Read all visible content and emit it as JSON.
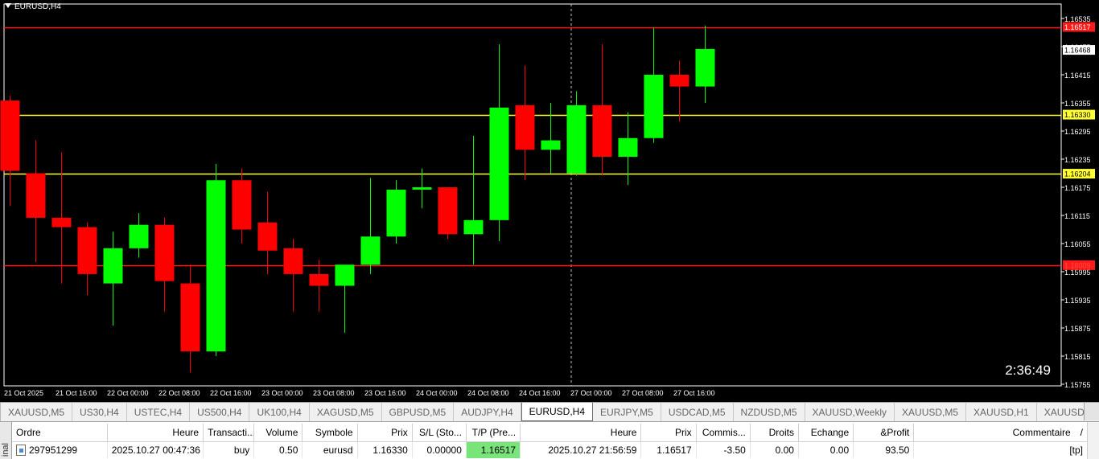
{
  "chart": {
    "title": "EURUSD,H4",
    "timer": "2:36:49",
    "price_labels": [
      "1.16535",
      "1.16475",
      "1.16415",
      "1.16355",
      "1.16295",
      "1.16235",
      "1.16175",
      "1.16115",
      "1.16055",
      "1.15995",
      "1.15935",
      "1.15875",
      "1.15815",
      "1.15755"
    ],
    "markers": [
      {
        "label": "1.16517",
        "price": 1.16517,
        "line_color": "#ff1a1a",
        "badge_bg": "#ff1a1a",
        "badge_fg": "#ffffff"
      },
      {
        "label": "1.16468",
        "price": 1.16468,
        "line_color": null,
        "badge_bg": "#ffffff",
        "badge_fg": "#000000"
      },
      {
        "label": "1.16330",
        "price": 1.1633,
        "line_color": "#ffff33",
        "badge_bg": "#ffff33",
        "badge_fg": "#000000"
      },
      {
        "label": "1.16204",
        "price": 1.16204,
        "line_color": "#ffff33",
        "badge_bg": "#ffff33",
        "badge_fg": "#000000"
      },
      {
        "label": "1.16009",
        "price": 1.16009,
        "line_color": "#ff1a1a",
        "badge_bg": "#ff1a1a",
        "badge_fg": "#ff4d4d"
      }
    ],
    "time_labels": [
      "21 Oct 2025",
      "21 Oct 16:00",
      "22 Oct 00:00",
      "22 Oct 08:00",
      "22 Oct 16:00",
      "23 Oct 00:00",
      "23 Oct 08:00",
      "23 Oct 16:00",
      "24 Oct 00:00",
      "24 Oct 08:00",
      "24 Oct 16:00",
      "27 Oct 00:00",
      "27 Oct 08:00",
      "27 Oct 16:00"
    ],
    "colors": {
      "bull": "#00ff00",
      "bear": "#ff0000",
      "background": "#000000",
      "grid_text": "#ffffff"
    }
  },
  "chart_data": {
    "type": "candlestick",
    "title": "EURUSD,H4",
    "xlabel": "",
    "ylabel": "",
    "ylim": [
      1.1573,
      1.1656
    ],
    "grid": false,
    "candles": [
      {
        "o": 1.1636,
        "h": 1.1637,
        "l": 1.16135,
        "c": 1.1621
      },
      {
        "o": 1.16205,
        "h": 1.16275,
        "l": 1.16015,
        "c": 1.1611
      },
      {
        "o": 1.1611,
        "h": 1.1625,
        "l": 1.1597,
        "c": 1.1609
      },
      {
        "o": 1.1609,
        "h": 1.161,
        "l": 1.15945,
        "c": 1.1599
      },
      {
        "o": 1.1597,
        "h": 1.1608,
        "l": 1.1588,
        "c": 1.16045
      },
      {
        "o": 1.16045,
        "h": 1.1612,
        "l": 1.16025,
        "c": 1.16095
      },
      {
        "o": 1.16095,
        "h": 1.1611,
        "l": 1.1591,
        "c": 1.15975
      },
      {
        "o": 1.1597,
        "h": 1.1601,
        "l": 1.1578,
        "c": 1.15825
      },
      {
        "o": 1.15825,
        "h": 1.16225,
        "l": 1.15815,
        "c": 1.1619
      },
      {
        "o": 1.1619,
        "h": 1.16215,
        "l": 1.16055,
        "c": 1.16085
      },
      {
        "o": 1.161,
        "h": 1.16165,
        "l": 1.1599,
        "c": 1.1604
      },
      {
        "o": 1.16045,
        "h": 1.16065,
        "l": 1.1591,
        "c": 1.1599
      },
      {
        "o": 1.1599,
        "h": 1.1602,
        "l": 1.1591,
        "c": 1.15965
      },
      {
        "o": 1.15965,
        "h": 1.16005,
        "l": 1.15865,
        "c": 1.1601
      },
      {
        "o": 1.1601,
        "h": 1.16195,
        "l": 1.1599,
        "c": 1.1607
      },
      {
        "o": 1.1607,
        "h": 1.1619,
        "l": 1.16055,
        "c": 1.1617
      },
      {
        "o": 1.1617,
        "h": 1.16215,
        "l": 1.1613,
        "c": 1.16175
      },
      {
        "o": 1.16175,
        "h": 1.16175,
        "l": 1.16065,
        "c": 1.16075
      },
      {
        "o": 1.16075,
        "h": 1.16285,
        "l": 1.1601,
        "c": 1.16105
      },
      {
        "o": 1.16105,
        "h": 1.1648,
        "l": 1.1606,
        "c": 1.16345
      },
      {
        "o": 1.1635,
        "h": 1.16435,
        "l": 1.1619,
        "c": 1.16255
      },
      {
        "o": 1.16255,
        "h": 1.16355,
        "l": 1.16205,
        "c": 1.16275
      },
      {
        "o": 1.16205,
        "h": 1.1638,
        "l": 1.162,
        "c": 1.1635
      },
      {
        "o": 1.1635,
        "h": 1.1648,
        "l": 1.162,
        "c": 1.1624
      },
      {
        "o": 1.1624,
        "h": 1.16335,
        "l": 1.1618,
        "c": 1.1628
      },
      {
        "o": 1.1628,
        "h": 1.16515,
        "l": 1.1627,
        "c": 1.16415
      },
      {
        "o": 1.16415,
        "h": 1.16445,
        "l": 1.16315,
        "c": 1.1639
      },
      {
        "o": 1.1639,
        "h": 1.1652,
        "l": 1.16355,
        "c": 1.1647
      }
    ]
  },
  "tabs": [
    "XAUUSD,M5",
    "US30,H4",
    "USTEC,H4",
    "US500,H4",
    "UK100,H4",
    "XAGUSD,M5",
    "GBPUSD,M5",
    "AUDJPY,H4",
    "EURUSD,H4",
    "EURJPY,M5",
    "USDCAD,M5",
    "NZDUSD,M5",
    "XAUUSD,Weekly",
    "XAUUSD,M5",
    "XAUUSD,H1",
    "XAUUSD,H"
  ],
  "active_tab": "EURUSD,H4",
  "terminal": {
    "side_label": "inal",
    "headers": [
      "Ordre",
      "Heure",
      "Transacti...",
      "Volume",
      "Symbole",
      "Prix",
      "S/L (Sto...",
      "T/P (Pre...",
      "Heure",
      "Prix",
      "Commis...",
      "Droits",
      "Echange",
      "&Profit",
      "Commentaire"
    ],
    "sort_indicator": "/",
    "rows": [
      {
        "ordre": "297951299",
        "heure": "2025.10.27 00:47:36",
        "transaction": "buy",
        "volume": "0.50",
        "symbole": "eurusd",
        "prix": "1.16330",
        "sl": "0.00000",
        "tp": "1.16517",
        "heure2": "2025.10.27 21:56:59",
        "prix2": "1.16517",
        "commission": "-3.50",
        "droits": "0.00",
        "echange": "0.00",
        "profit": "93.50",
        "commentaire": "[tp]"
      }
    ]
  }
}
